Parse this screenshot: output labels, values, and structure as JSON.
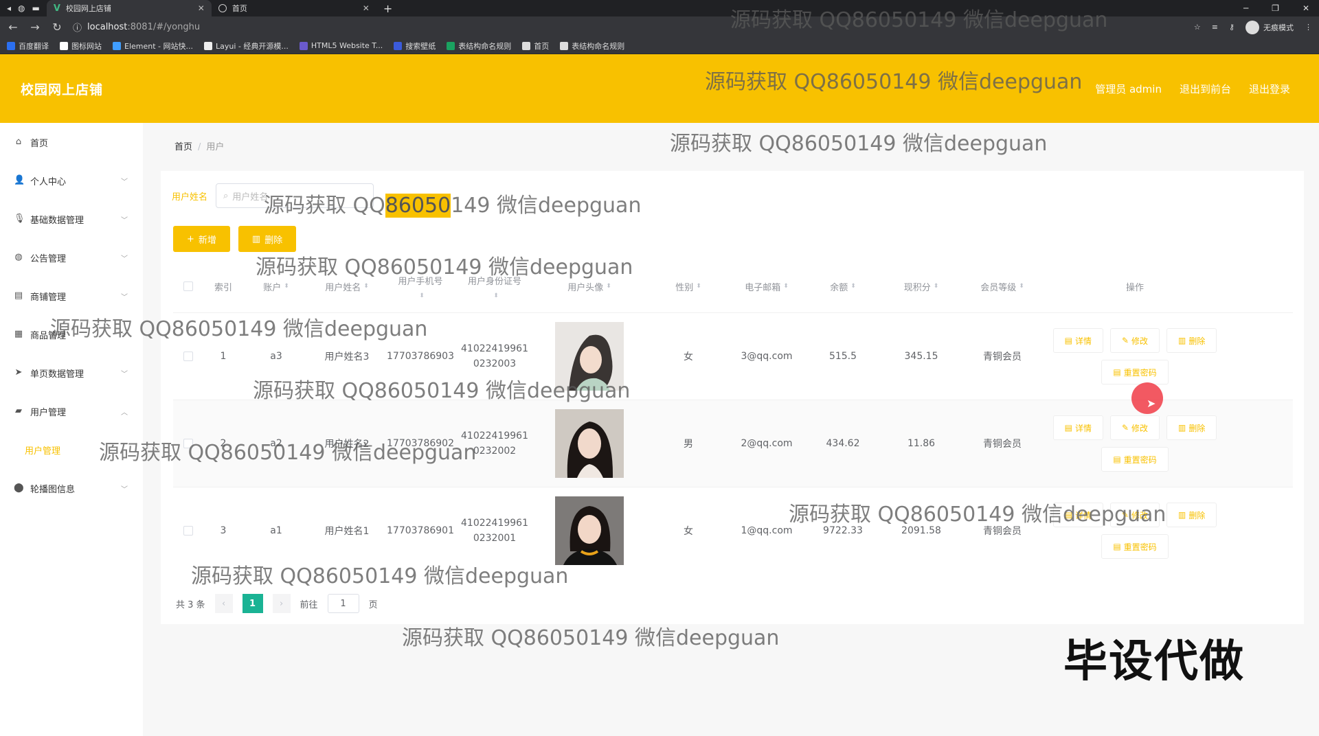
{
  "browser": {
    "tabs": [
      {
        "title": "校园网上店铺",
        "active": true
      },
      {
        "title": "首页",
        "active": false
      }
    ],
    "url_host": "localhost",
    "url_rest": ":8081/#/yonghu",
    "incognito_label": "无痕模式",
    "bookmarks": [
      {
        "label": "百度翻译",
        "color": "#2b6ff0"
      },
      {
        "label": "图标网站",
        "color": "#ffffff"
      },
      {
        "label": "Element - 网站快...",
        "color": "#409eff"
      },
      {
        "label": "Layui - 经典开源模...",
        "color": "#eeeeee"
      },
      {
        "label": "HTML5 Website T...",
        "color": "#6a5acd"
      },
      {
        "label": "搜索壁纸",
        "color": "#3b5bdb"
      },
      {
        "label": "表结构命名规则",
        "color": "#1aa260"
      },
      {
        "label": "首页",
        "color": "#dddddd"
      },
      {
        "label": "表结构命名规则",
        "color": "#dddddd"
      }
    ]
  },
  "header": {
    "title": "校园网上店铺",
    "admin_label": "管理员 admin",
    "front_label": "退出到前台",
    "logout_label": "退出登录"
  },
  "sidebar": {
    "items": [
      {
        "label": "首页",
        "icon": "home-icon",
        "chevron": false
      },
      {
        "label": "个人中心",
        "icon": "user-icon",
        "chevron": true
      },
      {
        "label": "基础数据管理",
        "icon": "mic-icon",
        "chevron": true
      },
      {
        "label": "公告管理",
        "icon": "globe-icon",
        "chevron": true
      },
      {
        "label": "商铺管理",
        "icon": "chat-icon",
        "chevron": true
      },
      {
        "label": "商品管理",
        "icon": "grid-icon",
        "chevron": true
      },
      {
        "label": "单页数据管理",
        "icon": "send-icon",
        "chevron": true
      },
      {
        "label": "用户管理",
        "icon": "folder-icon",
        "chevron": true,
        "expanded": true
      },
      {
        "label": "轮播图信息",
        "icon": "pin-icon",
        "chevron": true
      }
    ],
    "submenu_active": "用户管理"
  },
  "breadcrumb": {
    "home": "首页",
    "current": "用户"
  },
  "search": {
    "label": "用户姓名",
    "placeholder": "用户姓名"
  },
  "buttons": {
    "add": "新增",
    "delete": "删除"
  },
  "table": {
    "headers": {
      "index": "索引",
      "account": "账户",
      "name": "用户姓名",
      "phone": "用户手机号",
      "idcard": "用户身份证号",
      "avatar": "用户头像",
      "sex": "性别",
      "email": "电子邮箱",
      "balance": "余额",
      "points": "现积分",
      "level": "会员等级",
      "ops": "操作"
    },
    "rows": [
      {
        "index": "1",
        "account": "a3",
        "name": "用户姓名3",
        "phone": "17703786903",
        "idcard_1": "41022419961",
        "idcard_2": "0232003",
        "sex": "女",
        "email": "3@qq.com",
        "balance": "515.5",
        "points": "345.15",
        "level": "青铜会员"
      },
      {
        "index": "2",
        "account": "a2",
        "name": "用户姓名2",
        "phone": "17703786902",
        "idcard_1": "41022419961",
        "idcard_2": "0232002",
        "sex": "男",
        "email": "2@qq.com",
        "balance": "434.62",
        "points": "11.86",
        "level": "青铜会员"
      },
      {
        "index": "3",
        "account": "a1",
        "name": "用户姓名1",
        "phone": "17703786901",
        "idcard_1": "41022419961",
        "idcard_2": "0232001",
        "sex": "女",
        "email": "1@qq.com",
        "balance": "9722.33",
        "points": "2091.58",
        "level": "青铜会员"
      }
    ],
    "op_labels": {
      "detail": "详情",
      "edit": "修改",
      "delete": "删除",
      "reset": "重置密码"
    }
  },
  "pager": {
    "total": "共 3 条",
    "page": "1",
    "goto": "前往",
    "goto_value": "1",
    "page_unit": "页"
  },
  "watermark": {
    "text": "源码获取 QQ86050149 微信deepguan",
    "hl_a": "源码获取 QQ",
    "hl_b": "86050",
    "hl_c": "149 微信deepguan",
    "stamp": "毕设代做"
  },
  "colors": {
    "accent": "#f8c100",
    "pager_active": "#1ab394"
  }
}
